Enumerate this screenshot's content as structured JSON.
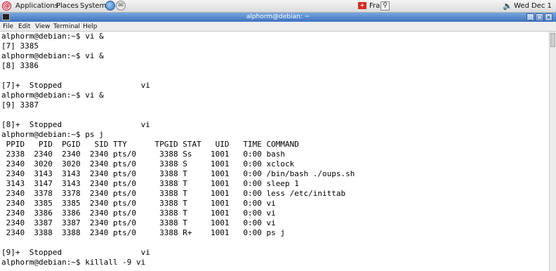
{
  "panel": {
    "logo_glyph": "@",
    "applications": "Applications",
    "places": "Places",
    "system": "System",
    "web_icon": "web-browser-icon",
    "mail_icon": "mail-icon",
    "mail_glyph": "✉",
    "flag_glyph": "+",
    "keyboard_layout": "Fra",
    "search_glyph": "⚲",
    "volume_glyph": "🔈",
    "clock": "Wed Dec 1"
  },
  "window": {
    "title": "alphorm@debian: ~",
    "minimize": "_",
    "maximize": "□",
    "close": "×"
  },
  "menubar": {
    "file": "File",
    "edit": "Edit",
    "view": "View",
    "terminal": "Terminal",
    "help": "Help"
  },
  "terminal": {
    "lines": [
      "alphorm@debian:~$ vi &",
      "[7] 3385",
      "alphorm@debian:~$ vi &",
      "[8] 3386",
      "",
      "[7]+  Stopped                 vi",
      "alphorm@debian:~$ vi &",
      "[9] 3387",
      "",
      "[8]+  Stopped                 vi",
      "alphorm@debian:~$ ps j",
      " PPID   PID  PGID   SID TTY      TPGID STAT   UID   TIME COMMAND",
      " 2338  2340  2340  2340 pts/0     3388 Ss    1001   0:00 bash",
      " 2340  3020  3020  2340 pts/0     3388 S     1001   0:00 xclock",
      " 2340  3143  3143  2340 pts/0     3388 T     1001   0:00 /bin/bash ./oups.sh",
      " 3143  3147  3143  2340 pts/0     3388 T     1001   0:00 sleep 1",
      " 2340  3378  3378  2340 pts/0     3388 T     1001   0:00 less /etc/inittab",
      " 2340  3385  3385  2340 pts/0     3388 T     1001   0:00 vi",
      " 2340  3386  3386  2340 pts/0     3388 T     1001   0:00 vi",
      " 2340  3387  3387  2340 pts/0     3388 T     1001   0:00 vi",
      " 2340  3388  3388  2340 pts/0     3388 R+    1001   0:00 ps j",
      "",
      "[9]+  Stopped                 vi",
      "alphorm@debian:~$ killall -9 vi"
    ]
  }
}
